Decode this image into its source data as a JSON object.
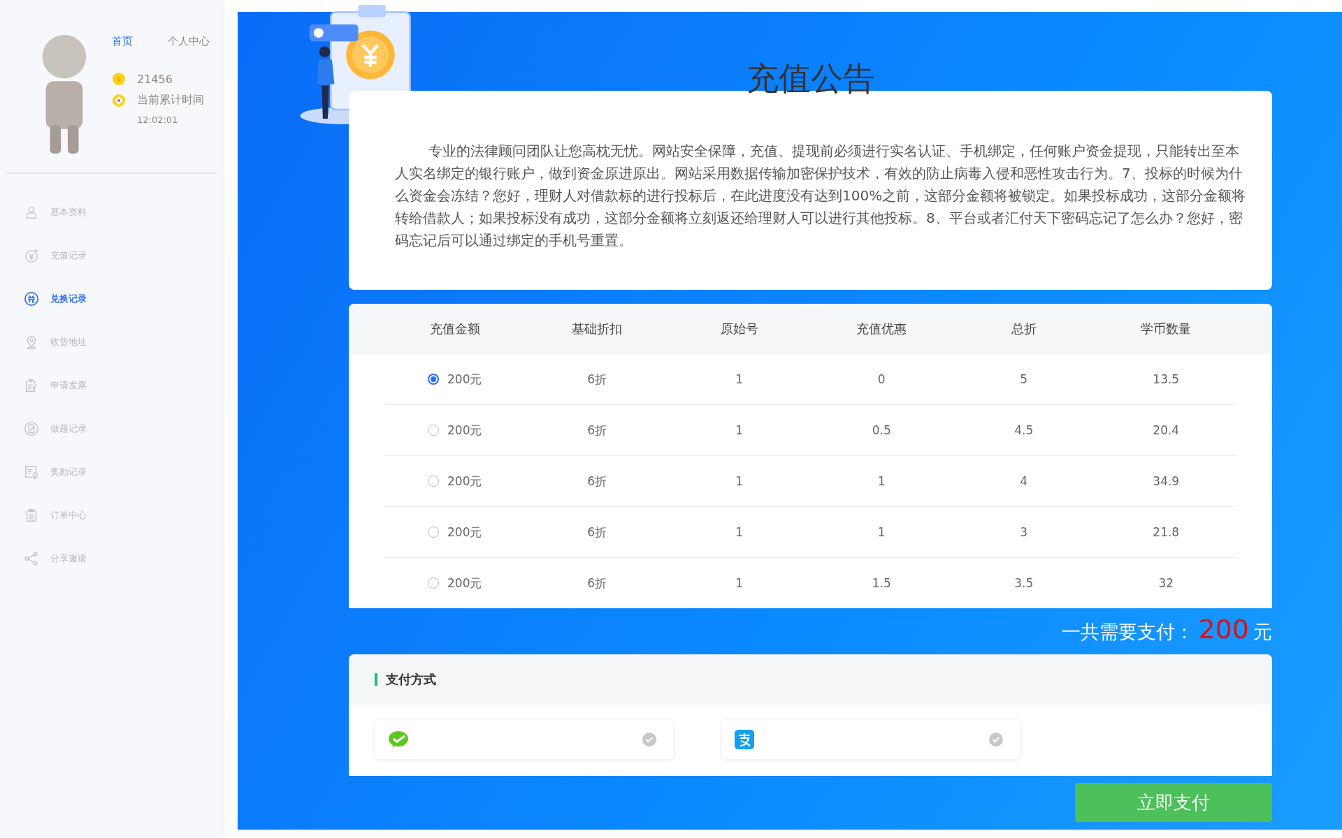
{
  "sidebar": {
    "nav": [
      {
        "label": "首页",
        "selected": true
      },
      {
        "label": "个人中心",
        "selected": false
      }
    ],
    "coins": "21456",
    "time_label": "当前累计时间",
    "time_value": "12:02:01",
    "menu": [
      {
        "label": "基本资料",
        "selected": false
      },
      {
        "label": "充值记录",
        "selected": false
      },
      {
        "label": "兑换记录",
        "selected": true
      },
      {
        "label": "收货地址",
        "selected": false
      },
      {
        "label": "申请发票",
        "selected": false
      },
      {
        "label": "做题记录",
        "selected": false
      },
      {
        "label": "奖励记录",
        "selected": false
      },
      {
        "label": "订单中心",
        "selected": false
      },
      {
        "label": "分享邀请",
        "selected": false
      }
    ]
  },
  "notice": {
    "title": "充值公告",
    "body": "专业的法律顾问团队让您高枕无忧。网站安全保障，充值、提现前必须进行实名认证、手机绑定，任何账户资金提现，只能转出至本人实名绑定的银行账户，做到资金原进原出。网站采用数据传输加密保护技术，有效的防止病毒入侵和恶性攻击行为。7、投标的时候为什么资金会冻结？您好，理财人对借款标的进行投标后，在此进度没有达到100%之前，这部分金额将被锁定。如果投标成功，这部分金额将转给借款人；如果投标没有成功，这部分金额将立刻返还给理财人可以进行其他投标。8、平台或者汇付天下密码忘记了怎么办？您好，密码忘记后可以通过绑定的手机号重置。"
  },
  "table": {
    "columns": [
      "充值金额",
      "基础折扣",
      "原始号",
      "充值优惠",
      "总折",
      "学币数量"
    ],
    "rows": [
      {
        "selected": true,
        "cells": [
          "200元",
          "6折",
          "1",
          "0",
          "5",
          "13.5"
        ]
      },
      {
        "selected": false,
        "cells": [
          "200元",
          "6折",
          "1",
          "0.5",
          "4.5",
          "20.4"
        ]
      },
      {
        "selected": false,
        "cells": [
          "200元",
          "6折",
          "1",
          "1",
          "4",
          "34.9"
        ]
      },
      {
        "selected": false,
        "cells": [
          "200元",
          "6折",
          "1",
          "1",
          "3",
          "21.8"
        ]
      },
      {
        "selected": false,
        "cells": [
          "200元",
          "6折",
          "1",
          "1.5",
          "3.5",
          "32"
        ]
      }
    ]
  },
  "total": {
    "label": "一共需要支付：",
    "amount": "200",
    "unit": "元"
  },
  "payment": {
    "title": "支付方式",
    "options": [
      {
        "kind": "wechat",
        "selected": false
      },
      {
        "kind": "alipay",
        "selected": false
      }
    ]
  },
  "pay_button": "立即支付"
}
